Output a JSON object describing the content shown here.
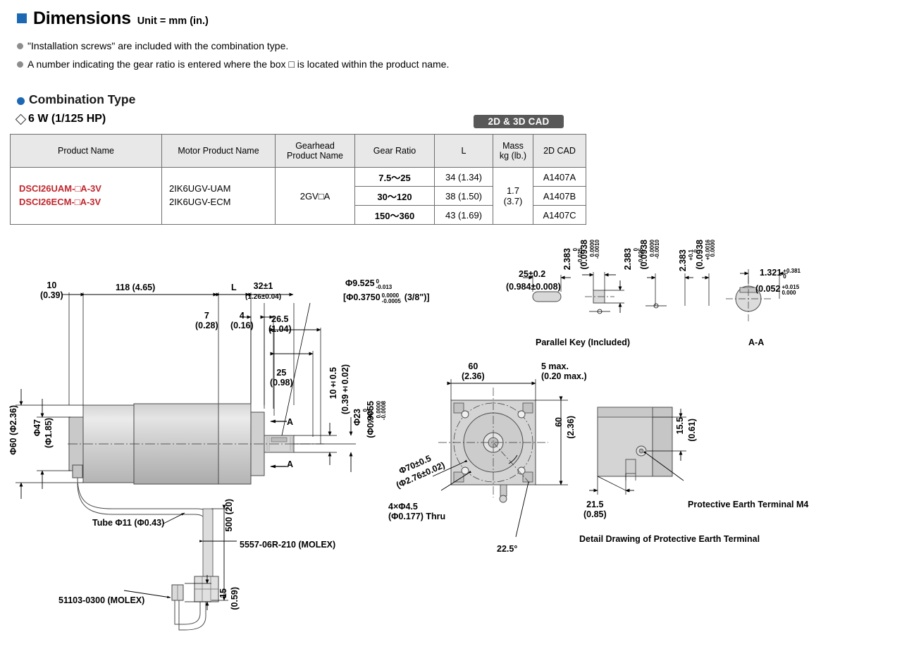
{
  "header": {
    "title": "Dimensions",
    "unit": "Unit = mm (in.)",
    "note1": "\"Installation screws\" are included with the combination type.",
    "note2": "A number indicating the gear ratio is entered where the box □ is located within the product name.",
    "section": "Combination Type",
    "wattage": "6 W (1/125 HP)",
    "cad_badge": "2D & 3D CAD",
    "accent_color": "#1d68b3",
    "product_color": "#c0272d"
  },
  "table": {
    "columns": [
      "Product Name",
      "Motor Product Name",
      "Gearhead Product Name",
      "Gear Ratio",
      "L",
      "Mass kg (lb.)",
      "2D CAD"
    ],
    "col_mass_line1": "Mass",
    "col_mass_line2": "kg (lb.)",
    "col_gearhead_line1": "Gearhead",
    "col_gearhead_line2": "Product Name",
    "product_names": [
      "DSCI26UAM-□A-3V",
      "DSCI26ECM-□A-3V"
    ],
    "motor_names": [
      "2IK6UGV-UAM",
      "2IK6UGV-ECM"
    ],
    "gearhead": "2GV□A",
    "mass_line1": "1.7",
    "mass_line2": "(3.7)",
    "rows": [
      {
        "ratio": "7.5～25",
        "L": "34 (1.34)",
        "cad": "A1407A"
      },
      {
        "ratio": "30～120",
        "L": "38 (1.50)",
        "cad": "A1407B"
      },
      {
        "ratio": "150～360",
        "L": "43 (1.69)",
        "cad": "A1407C"
      }
    ]
  },
  "drawing": {
    "side_view": {
      "d10": "10",
      "d10b": "(0.39)",
      "d118": "118 (4.65)",
      "dL": "L",
      "d32": "32±1",
      "d32b": "(1.26±0.04)",
      "d7": "7",
      "d7b": "(0.28)",
      "d4": "4",
      "d4b": "(0.16)",
      "d265": "26.5",
      "d265b": "(1.04)",
      "d25": "25",
      "d25b": "(0.98)",
      "shaft_dia": "Φ9.525",
      "shaft_tol_up": "0",
      "shaft_tol_dn": "-0.013",
      "shaft_inch": "[Φ0.3750",
      "shaft_inch_tol_up": "0.0000",
      "shaft_inch_tol_dn": "-0.0005",
      "shaft_inch_suffix": "(3/8\")]",
      "d10key": "10±0.5",
      "d10keyb": "(0.39±0.02)",
      "d23": "Φ23",
      "d23tol_up": "0",
      "d23tol_dn": "-0.021",
      "d23inch": "(Φ0.9055",
      "d23inch_up": "0.0000",
      "d23inch_dn": "-0.0008",
      "d60": "Φ60 (Φ2.36)",
      "d47": "Φ47",
      "d47b": "(Φ1.85)",
      "sectionA": "A",
      "tube": "Tube Φ11 (Φ0.43)",
      "d500": "500 (20)",
      "d15": "15",
      "d15b": "(0.59)",
      "molex1": "5557-06R-210 (MOLEX)",
      "molex2": "51103-0300 (MOLEX)"
    },
    "front_view": {
      "d60_top": "60",
      "d60_topb": "(2.36)",
      "d5max": "5 max.",
      "d5maxb": "(0.20 max.)",
      "d60_right": "60",
      "d60_rightb": "(2.36)",
      "d70": "Φ70±0.5",
      "d70b": "(Φ2.76±0.02)",
      "holes": "4×Φ4.5",
      "holesb": "(Φ0.177) Thru",
      "angle": "22.5°"
    },
    "key_view": {
      "d25": "25±0.2",
      "d25b": "(0.984±0.008)",
      "d2383": "2.383",
      "d2383_up": "0",
      "d2383_dn": "-0.025",
      "d0938": "(0.0938",
      "d0938_up": "0.0000",
      "d0938_dn": "-0.0010",
      "label": "Parallel Key (Included)"
    },
    "aa_view": {
      "d2383": "2.383",
      "d2383_up": "0",
      "d2383_dn": "-0.025",
      "d0938": "(0.0938",
      "d0938_up": "0.0000",
      "d0938_dn": "-0.0010",
      "d2383b": "2.383",
      "d2383b_up": "+0.1",
      "d2383b_dn": "0",
      "d0938b": "(0.0938",
      "d0938b_up": "+0.0016",
      "d0938b_dn": "0.0000",
      "d1321": "1.321",
      "d1321_up": "+0.381",
      "d1321_dn": "0",
      "d052": "(0.052",
      "d052_up": "+0.015",
      "d052_dn": "0.000",
      "label": "A-A"
    },
    "earth_view": {
      "d155": "15.5",
      "d155b": "(0.61)",
      "d215": "21.5",
      "d215b": "(0.85)",
      "terminal": "Protective Earth Terminal M4",
      "caption": "Detail Drawing of Protective Earth Terminal"
    }
  }
}
